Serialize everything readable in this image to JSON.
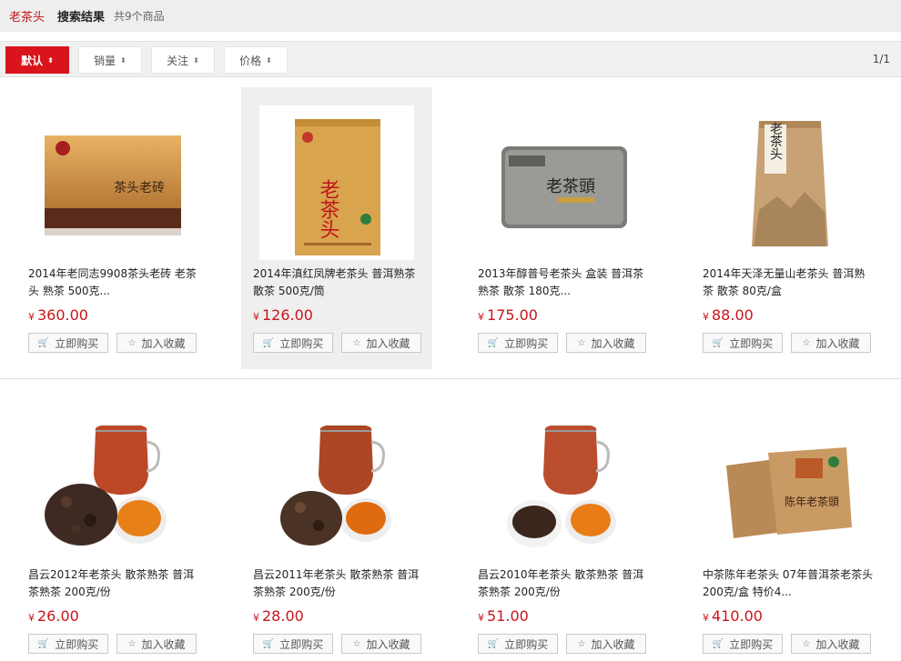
{
  "topbar": {
    "keyword": "老茶头",
    "label": "搜索结果",
    "count": "共9个商品"
  },
  "sort": {
    "items": [
      {
        "label": "默认",
        "active": true
      },
      {
        "label": "销量",
        "active": false
      },
      {
        "label": "关注",
        "active": false
      },
      {
        "label": "价格",
        "active": false
      }
    ],
    "pager": "1/1"
  },
  "buttons": {
    "buy": "立即购买",
    "fav": "加入收藏",
    "currency": "¥"
  },
  "products": [
    {
      "title": "2014年老同志9908茶头老砖 老茶头 熟茶 500克...",
      "price": "360.00"
    },
    {
      "title": "2014年滇红凤牌老茶头 普洱熟茶 散茶 500克/筒",
      "price": "126.00"
    },
    {
      "title": "2013年醇普号老茶头 盒装 普洱茶 熟茶 散茶 180克...",
      "price": "175.00"
    },
    {
      "title": "2014年天泽无量山老茶头 普洱熟茶 散茶 80克/盒",
      "price": "88.00"
    },
    {
      "title": "昌云2012年老茶头 散茶熟茶 普洱茶熟茶 200克/份",
      "price": "26.00"
    },
    {
      "title": "昌云2011年老茶头 散茶熟茶 普洱茶熟茶 200克/份",
      "price": "28.00"
    },
    {
      "title": "昌云2010年老茶头 散茶熟茶 普洱茶熟茶 200克/份",
      "price": "51.00"
    },
    {
      "title": "中茶陈年老茶头 07年普洱茶老茶头 200克/盒 特价4...",
      "price": "410.00"
    }
  ],
  "packaging": {
    "p1_box_text": "茶头老砖",
    "p2_bag_text": "老茶头",
    "p3_tin_text": "老茶頭",
    "p4_bag_text": "老茶头",
    "p8_pkg_text": "陈年老茶頭"
  }
}
